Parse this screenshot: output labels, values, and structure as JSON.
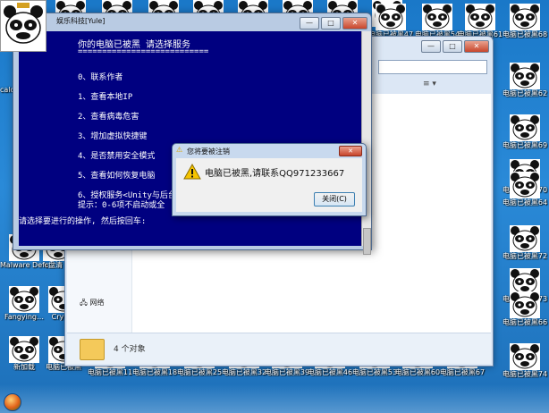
{
  "desktop": {
    "top_row": [
      "",
      "",
      "",
      "",
      "",
      "",
      "",
      "",
      ""
    ],
    "top_right_labels": [
      "电脑已被黑47",
      "电脑已被黑54",
      "电脑已被黑61",
      "电脑已被黑68"
    ],
    "right_col_labels": [
      "电脑已被黑62",
      "电脑已被黑69",
      "电脑已被黑70",
      "电脑已被黑64",
      "电脑已被黑72",
      "电脑已被黑73",
      "电脑已被黑66",
      "电脑已被黑74"
    ],
    "left_labels": [
      "Malware\nDefender",
      "c盘清\n…",
      "Fangying…",
      "Cryp…",
      "新加载",
      "电脑已被黑"
    ],
    "bottom_row": [
      "电脑已被黑11",
      "电脑已被黑18",
      "电脑已被黑25",
      "电脑已被黑32",
      "电脑已被黑39",
      "电脑已被黑46",
      "电脑已被黑53",
      "电脑已被黑60",
      "电脑已被黑67"
    ],
    "partial_left": "calc"
  },
  "explorer": {
    "network_label": "网络",
    "status_text": "4 个对象",
    "toolbar": "≡ ▾"
  },
  "console": {
    "title": "娱乐科技[Yule]",
    "heading": "你的电脑已被黑 请选择服务",
    "separator": "===========================",
    "options": [
      "0、联系作者",
      "1、查看本地IP",
      "2、查看病毒危害",
      "3、增加虚拟快捷键",
      "4、是否禁用安全模式",
      "5、查看如何恢复电脑",
      "6、授权服务<Unity与后台"
    ],
    "hint": "提示：0-6项不启动或全",
    "prompt": "请选择要进行的操作, 然后按回车:"
  },
  "dialog": {
    "title": "您将要被注销",
    "message": "电脑已被黑,请联系QQ971233667",
    "close_label": "关闭(C)"
  },
  "colors": {
    "console_bg": "#000080",
    "desktop_bg": "#1d7ac9"
  }
}
